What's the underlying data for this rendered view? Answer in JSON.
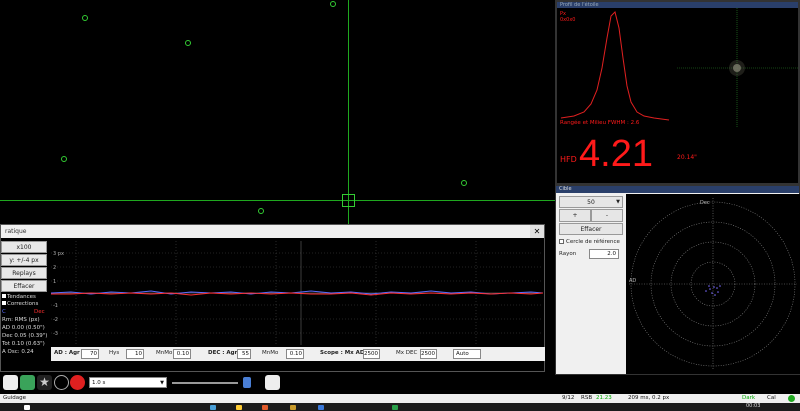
{
  "graph": {
    "title_text": "ratique",
    "close_glyph": "✕",
    "buttons": {
      "scale": "x100",
      "y_scale": "y: +/-4 px",
      "replay": "Replays",
      "clear": "Effacer"
    },
    "checks": {
      "trends": "Tendances",
      "corrections": "Corrections"
    },
    "legend": {
      "ra": "C",
      "dec": "Dec"
    },
    "stats": {
      "rms": "Rm: RMS (px)",
      "ad": "AD 0.00 (0.50\")",
      "dec": "Dec 0.05 (0.39\")",
      "tot": "Tot 0.10 (0.63\")",
      "osc": "A Osc: 0.24"
    },
    "y_ticks": [
      "3 px",
      "2",
      "1",
      "-1",
      "-2",
      "-3"
    ],
    "controls": {
      "ad_aggr_label": "AD : Agr",
      "ad_aggr": "70",
      "hys_label": "Hys",
      "hys": "10",
      "mnmo_label": "MnMo",
      "mnmo": "0.10",
      "dec_label": "DEC : Agr",
      "dec_aggr": "55",
      "mnmo2_label": "MnMo",
      "mnmo2": "0.10",
      "scope_label": "Scope : Mx AD",
      "mx_ad": "2500",
      "mx_dec_label": "Mx DEC",
      "mx_dec": "2500",
      "mode": "Auto"
    }
  },
  "profile": {
    "title": "Profil de l'étoile",
    "label_top": "Px",
    "label_top2": "0x0x0",
    "caption": "Rangée et Milieu FWHM : 2.6",
    "hfd_label": "HFD",
    "hfd_value": "4.21",
    "hfd_arcsec": "20.14\""
  },
  "target": {
    "title": "Cible",
    "select": "50",
    "plus": "+",
    "minus": "-",
    "clear": "Effacer",
    "ref_circle": "Cercle de référence",
    "radius_label": "Rayon",
    "radius_value": "2.0",
    "north": "Dec",
    "west": "AD"
  },
  "toolbar": {
    "exposure": "1.0 s"
  },
  "status": {
    "text": "Guidage",
    "frames": "9/12",
    "snr_label": "RSB",
    "snr": "21.23",
    "info": "209 ms, 0.2 px",
    "dark": "Dark",
    "cal": "Cal"
  },
  "taskbar": {
    "time": "00:03"
  },
  "colors": {
    "ra": "#5a6cff",
    "dec": "#ff3030",
    "grid": "#1fa81f",
    "red": "#ff1a1a"
  }
}
